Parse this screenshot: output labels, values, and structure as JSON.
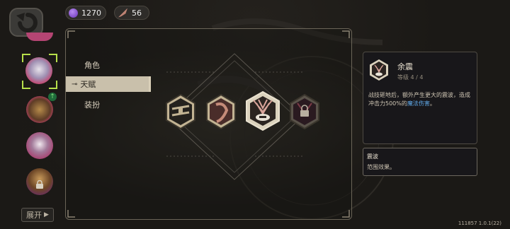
{
  "currency": {
    "gems": "1270",
    "feathers": "56"
  },
  "tabs": [
    {
      "label": "角色"
    },
    {
      "label": "天赋"
    },
    {
      "label": "装扮"
    }
  ],
  "expand_button": "展开",
  "skill_detail": {
    "name": "余震",
    "level": "等级 4 / 4",
    "desc_line1": "战技砸地后，额外产生更大的震波，造成",
    "desc_line2_prefix": "冲击力500%的",
    "desc_line2_highlight": "魔法伤害",
    "desc_line2_suffix": "。"
  },
  "sub_skill": {
    "name": "震波",
    "desc": "范围效果。"
  },
  "version": "111857 1.0.1(22)",
  "colors": {
    "highlight_text": "#5fa8e8",
    "active_tab": "#c9c0ab",
    "gold_border": "#c9b27a"
  }
}
